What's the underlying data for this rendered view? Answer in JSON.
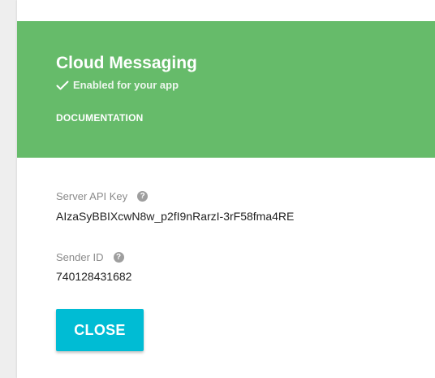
{
  "dialog": {
    "title": "Cloud Messaging",
    "status_text": "Enabled for your app",
    "documentation_label": "DOCUMENTATION",
    "colors": {
      "header": "#66bb6a",
      "button": "#00bcd4"
    },
    "fields": [
      {
        "label": "Server API Key",
        "value": "AIzaSyBBIXcwN8w_p2fI9nRarzI-3rF58fma4RE",
        "icon": "help-icon"
      },
      {
        "label": "Sender ID",
        "value": "740128431682",
        "icon": "help-icon"
      }
    ],
    "close_label": "CLOSE"
  }
}
